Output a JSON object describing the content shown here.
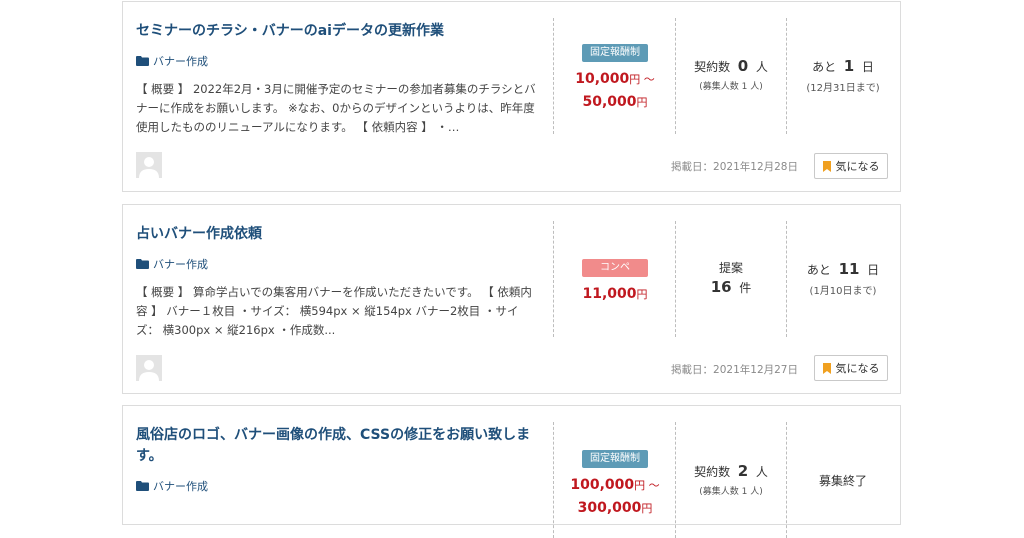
{
  "jobs": [
    {
      "title": "セミナーのチラシ・バナーのaiデータの更新作業",
      "category": "バナー作成",
      "description": "【 概要 】 2022年2月・3月に開催予定のセミナーの参加者募集のチラシとバナーに作成をお願いします。 ※なお、0からのデザインというよりは、昨年度使用したもののリニューアルになります。 【 依頼内容 】 ・…",
      "badge": "固定報酬制",
      "price_line1": "10,000",
      "price_unit1": "円 ～",
      "price_line2": "50,000",
      "price_unit2": "円",
      "contract_label": "契約数",
      "contract_count": "0",
      "contract_unit": "人",
      "contract_sub": "(募集人数 1 人)",
      "deadline_prefix": "あと",
      "deadline_days": "1",
      "deadline_unit": "日",
      "deadline_sub": "(12月31日まで)",
      "posted": "掲載日：2021年12月28日",
      "fav_label": "気になる"
    },
    {
      "title": "占いバナー作成依頼",
      "category": "バナー作成",
      "description": "【 概要 】 算命学占いでの集客用バナーを作成いただきたいです。 【 依頼内容 】 バナー１枚目 ・サイズ： 横594px × 縦154px バナー2枚目 ・サイズ： 横300px × 縦216px ・作成数...",
      "badge": "コンペ",
      "price_line1": "11,000",
      "price_unit1": "円",
      "proposal_label": "提案",
      "proposal_count": "16",
      "proposal_unit": "件",
      "deadline_prefix": "あと",
      "deadline_days": "11",
      "deadline_unit": "日",
      "deadline_sub": "(1月10日まで)",
      "posted": "掲載日：2021年12月27日",
      "fav_label": "気になる"
    },
    {
      "title": "風俗店のロゴ、バナー画像の作成、CSSの修正をお願い致します。",
      "category": "バナー作成",
      "badge": "固定報酬制",
      "price_line1": "100,000",
      "price_unit1": "円 ～",
      "price_line2": "300,000",
      "price_unit2": "円",
      "contract_label": "契約数",
      "contract_count": "2",
      "contract_unit": "人",
      "contract_sub": "(募集人数 1 人)",
      "status": "募集終了"
    }
  ],
  "colors": {
    "title": "#1f4f7a",
    "price": "#c0181f",
    "badge_fixed": "#5e9bb6",
    "badge_compe": "#f18b8b",
    "bookmark": "#f0a020"
  }
}
